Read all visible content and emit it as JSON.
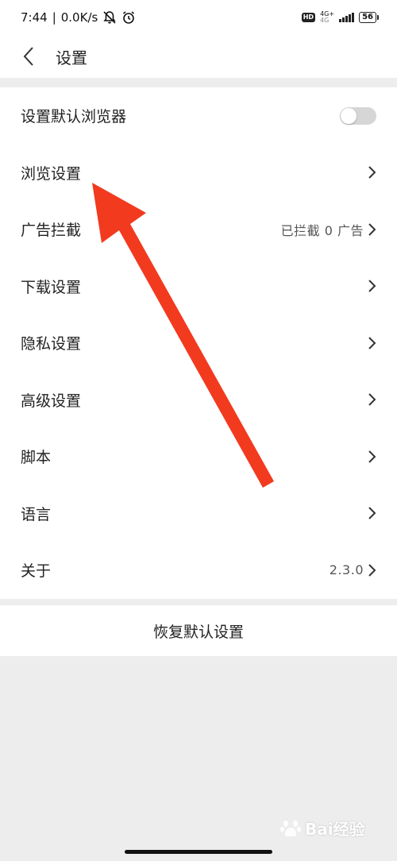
{
  "status_bar": {
    "time": "7:44",
    "speed": "0.0K/s",
    "network_badge": "HD",
    "network_type_top": "4G+",
    "network_type_bottom": "4G",
    "battery": "56"
  },
  "header": {
    "title": "设置"
  },
  "settings": {
    "default_browser": {
      "label": "设置默认浏览器",
      "toggle_on": false
    },
    "browse": {
      "label": "浏览设置"
    },
    "adblock": {
      "label": "广告拦截",
      "value": "已拦截 0 广告"
    },
    "download": {
      "label": "下载设置"
    },
    "privacy": {
      "label": "隐私设置"
    },
    "advanced": {
      "label": "高级设置"
    },
    "script": {
      "label": "脚本"
    },
    "language": {
      "label": "语言"
    },
    "about": {
      "label": "关于",
      "value": "2.3.0"
    }
  },
  "restore": {
    "label": "恢复默认设置"
  },
  "watermark": {
    "text": "Bai经验"
  },
  "colors": {
    "arrow": "#f23a1f",
    "background": "#ededed",
    "toggle_off": "#d6d6d6"
  }
}
